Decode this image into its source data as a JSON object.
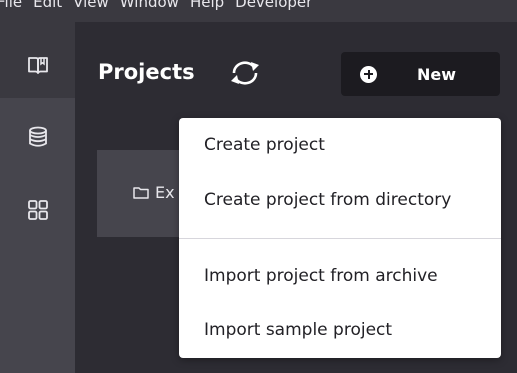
{
  "menubar": {
    "items": [
      "File",
      "Edit",
      "View",
      "Window",
      "Help",
      "Developer"
    ]
  },
  "sidebar": {
    "items": [
      {
        "icon": "book-open-icon",
        "active": true
      },
      {
        "icon": "database-icon",
        "active": false
      },
      {
        "icon": "grid-icon",
        "active": false
      }
    ]
  },
  "header": {
    "title": "Projects",
    "refresh_icon": "sync-icon",
    "new_label": "New"
  },
  "project_card": {
    "label": "Ex"
  },
  "dropdown": {
    "items": [
      "Create project",
      "Create project from directory",
      "Import project from archive",
      "Import sample project"
    ]
  },
  "colors": {
    "background": "#2d2c33",
    "sidebar": "#3a3940",
    "button": "#1c1b20",
    "menu": "#ffffff"
  }
}
